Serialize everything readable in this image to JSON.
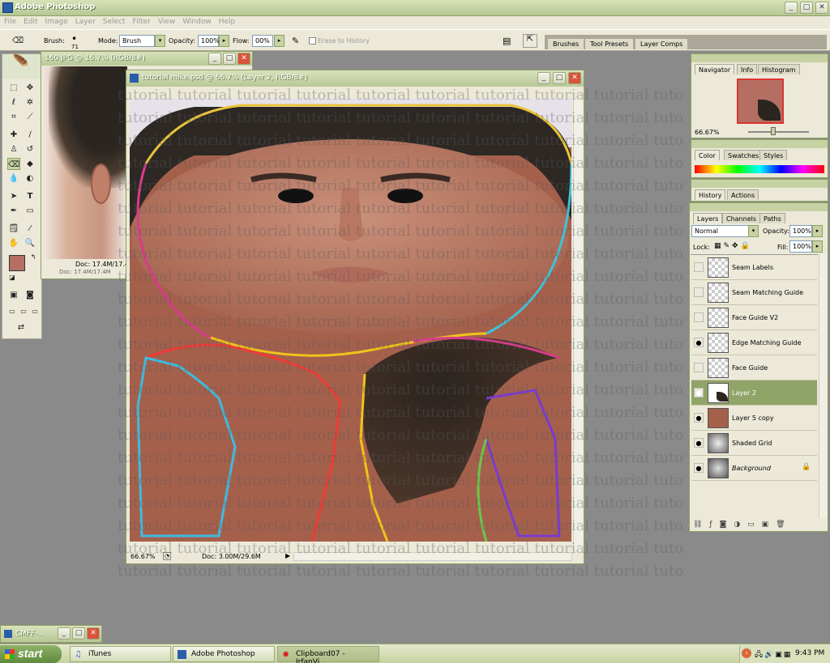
{
  "app": {
    "title": "Adobe Photoshop"
  },
  "menu": [
    "File",
    "Edit",
    "Image",
    "Layer",
    "Select",
    "Filter",
    "View",
    "Window",
    "Help"
  ],
  "options": {
    "brush_label": "Brush:",
    "brush_size": "71",
    "mode_label": "Mode:",
    "mode_value": "Brush",
    "opacity_label": "Opacity:",
    "opacity_value": "100%",
    "flow_label": "Flow:",
    "flow_value": "00%",
    "erase_history_label": "Erase to History",
    "palette_tabs": [
      "Brushes",
      "Tool Presets",
      "Layer Comps"
    ]
  },
  "back_doc": {
    "title": "160.JPG @ 16.7% (RGB/8#)",
    "doc_info": "Doc: 17.4M/17.4",
    "doc_info2": "Doc: 17.4M/17.4M"
  },
  "main_doc": {
    "title": "tutorial mike.psd @ 66.7% (Layer 2, RGB/8#)",
    "zoom": "66.67%",
    "doc_info": "Doc: 3.00M/29.6M"
  },
  "watermark_text": "tutorial",
  "navigator": {
    "tabs": [
      "Navigator",
      "Info",
      "Histogram"
    ],
    "zoom": "66.67%"
  },
  "color_panel": {
    "tabs": [
      "Color",
      "Swatches",
      "Styles"
    ]
  },
  "history_panel": {
    "tabs": [
      "History",
      "Actions"
    ]
  },
  "layers_panel": {
    "tabs": [
      "Layers",
      "Channels",
      "Paths"
    ],
    "blend_mode": "Normal",
    "opacity_label": "Opacity:",
    "opacity_value": "100%",
    "lock_label": "Lock:",
    "fill_label": "Fill:",
    "fill_value": "100%",
    "layers": [
      {
        "name": "Seam Labels",
        "visible": false,
        "selected": false
      },
      {
        "name": "Seam Matching Guide",
        "visible": false,
        "selected": false
      },
      {
        "name": "Face Guide V2",
        "visible": false,
        "selected": false
      },
      {
        "name": "Edge Matching Guide",
        "visible": true,
        "selected": false
      },
      {
        "name": "Face Guide",
        "visible": false,
        "selected": false
      },
      {
        "name": "Layer 2",
        "visible": true,
        "selected": true
      },
      {
        "name": "Layer 5 copy",
        "visible": true,
        "selected": false
      },
      {
        "name": "Shaded Grid",
        "visible": true,
        "selected": false
      },
      {
        "name": "Background",
        "visible": true,
        "selected": false
      }
    ]
  },
  "minimized_window": {
    "title": "CMFF-..."
  },
  "taskbar": {
    "start": "start",
    "items": [
      "iTunes",
      "Adobe Photoshop",
      "Clipboard07 - IrfanVi..."
    ],
    "clock": "9:43 PM"
  },
  "colors": {
    "xp_olive": "#b6c794",
    "skin": "#a5604c",
    "selected_layer": "#90a468"
  }
}
